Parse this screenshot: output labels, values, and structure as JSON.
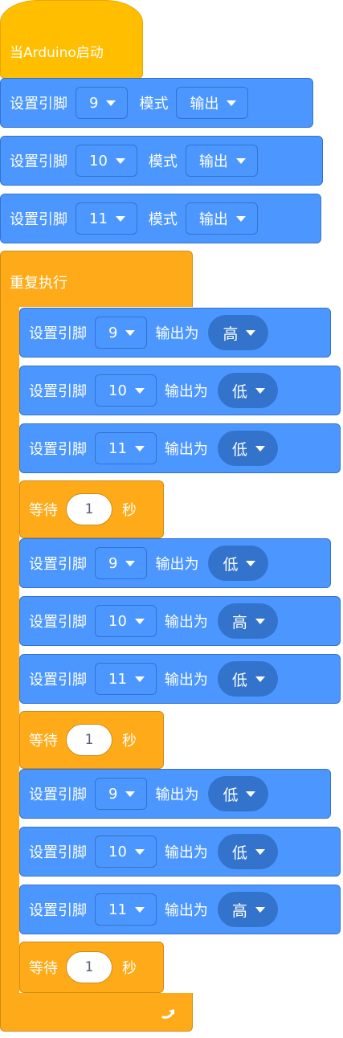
{
  "event": {
    "label": "当Arduino启动"
  },
  "setup": [
    {
      "prefix": "设置引脚",
      "pin": "9",
      "mode_label": "模式",
      "mode": "输出"
    },
    {
      "prefix": "设置引脚",
      "pin": "10",
      "mode_label": "模式",
      "mode": "输出"
    },
    {
      "prefix": "设置引脚",
      "pin": "11",
      "mode_label": "模式",
      "mode": "输出"
    }
  ],
  "loop": {
    "label": "重复执行"
  },
  "writes": [
    {
      "prefix": "设置引脚",
      "pin": "9",
      "out_label": "输出为",
      "level": "高"
    },
    {
      "prefix": "设置引脚",
      "pin": "10",
      "out_label": "输出为",
      "level": "低"
    },
    {
      "prefix": "设置引脚",
      "pin": "11",
      "out_label": "输出为",
      "level": "低"
    },
    {
      "prefix": "设置引脚",
      "pin": "9",
      "out_label": "输出为",
      "level": "低"
    },
    {
      "prefix": "设置引脚",
      "pin": "10",
      "out_label": "输出为",
      "level": "高"
    },
    {
      "prefix": "设置引脚",
      "pin": "11",
      "out_label": "输出为",
      "level": "低"
    },
    {
      "prefix": "设置引脚",
      "pin": "9",
      "out_label": "输出为",
      "level": "低"
    },
    {
      "prefix": "设置引脚",
      "pin": "10",
      "out_label": "输出为",
      "level": "低"
    },
    {
      "prefix": "设置引脚",
      "pin": "11",
      "out_label": "输出为",
      "level": "高"
    }
  ],
  "waits": [
    {
      "label": "等待",
      "value": "1",
      "unit": "秒"
    },
    {
      "label": "等待",
      "value": "1",
      "unit": "秒"
    },
    {
      "label": "等待",
      "value": "1",
      "unit": "秒"
    }
  ],
  "icons": {
    "dropdown": "triangle-down-icon",
    "loop_end": "loop-arrow-icon"
  },
  "colors": {
    "motion_blue": "#4c97ff",
    "control_orange": "#ffab19",
    "event_yellow": "#ffbf00"
  }
}
